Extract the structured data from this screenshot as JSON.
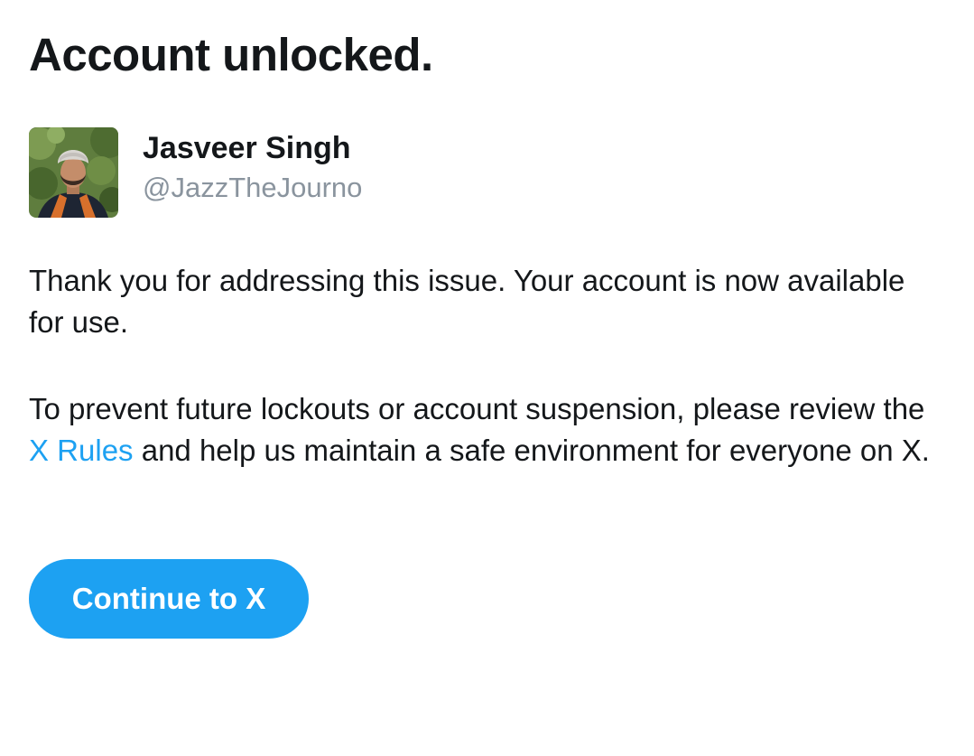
{
  "heading": "Account unlocked.",
  "user": {
    "name": "Jasveer Singh",
    "handle": "@JazzTheJourno",
    "avatar_icon": "profile-photo"
  },
  "message": {
    "paragraph1": "Thank you for addressing this issue. Your account is now available for use.",
    "paragraph2_before": "To prevent future lockouts or account suspension, please review the ",
    "rules_link": "X Rules",
    "paragraph2_after": " and help us maintain a safe environment for everyone on X."
  },
  "continue_button": "Continue to X",
  "colors": {
    "accent": "#1da1f2",
    "text": "#14171a",
    "secondary_text": "#8a949e",
    "background": "#ffffff"
  }
}
